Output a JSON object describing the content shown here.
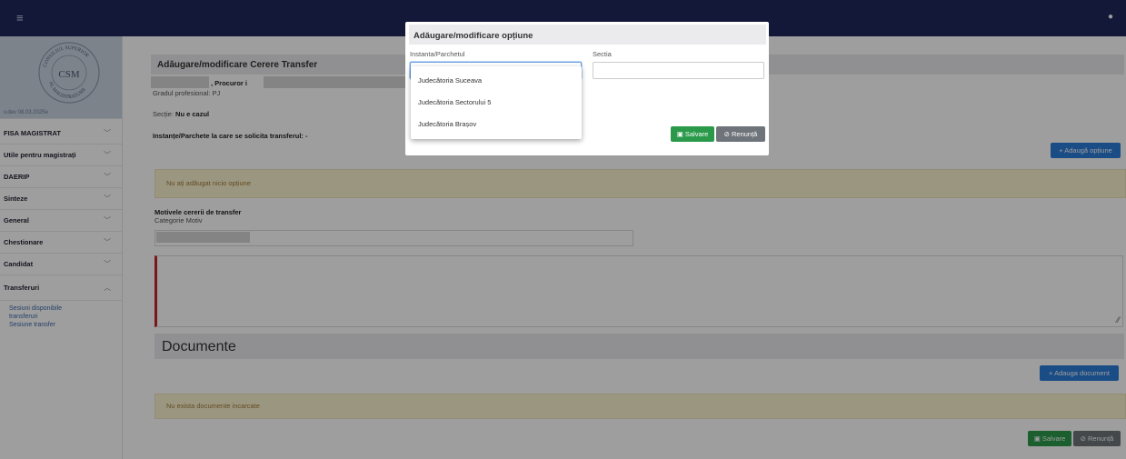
{
  "topbar": {
    "menu_icon": "hamburger-icon",
    "right_icon": "user-icon"
  },
  "sidebar": {
    "logo_text": "CONSILIUL SUPERIOR AL MAGISTRATURII",
    "logo_center": "CSM",
    "version": "v.dev 08.03.2025e",
    "items": [
      {
        "label": "FISA MAGISTRAT",
        "chevron": "﹀"
      },
      {
        "label": "Utile pentru magistrați",
        "chevron": "﹀"
      },
      {
        "label": "DAERIP",
        "chevron": "﹀"
      },
      {
        "label": "Sinteze",
        "chevron": "﹀"
      },
      {
        "label": "General",
        "chevron": "﹀"
      },
      {
        "label": "Chestionare",
        "chevron": "﹀"
      },
      {
        "label": "Candidat",
        "chevron": "﹀"
      },
      {
        "label": "Transferuri",
        "chevron": "︿"
      }
    ],
    "subitems": [
      "Sesiuni disponibile",
      "transferuri",
      "Sesiune transfer"
    ]
  },
  "main": {
    "title": "Adăugare/modificare Cerere Transfer",
    "procuror": ", Procuror i",
    "grad": "Gradul profesional: PJ",
    "sectie_label": "Secție:",
    "sectie_value": "Nu e cazul",
    "instante": "Instanțe/Parchete la care se solicita transferul: -",
    "add_option": "+ Adaugă opțiune",
    "no_options": "Nu ați adăugat nicio opțiune",
    "motive_title": "Motivele cererii de transfer",
    "motive_sub": "Categorie Motiv",
    "documente": "Documente",
    "add_document": "+ Adauga document",
    "no_documents": "Nu exista documente incarcate",
    "save": "Salvare",
    "cancel": "Renunță"
  },
  "modal": {
    "title": "Adăugare/modificare opțiune",
    "instanta_label": "Instanta/Parchetul",
    "sectia_label": "Sectia",
    "instanta_value": "",
    "sectia_value": "",
    "save": "Salvare",
    "cancel": "Renunță",
    "options": [
      "Judecătoria Suceava",
      "Judecătoria Sectorului 5",
      "Judecătoria Brașov"
    ]
  },
  "colors": {
    "topbar": "#20285c",
    "primary": "#2b7bd7",
    "success": "#2a9a4a",
    "secondary": "#6e747a",
    "warning_bg": "#faf2cf",
    "accent_red": "#c0272d"
  }
}
